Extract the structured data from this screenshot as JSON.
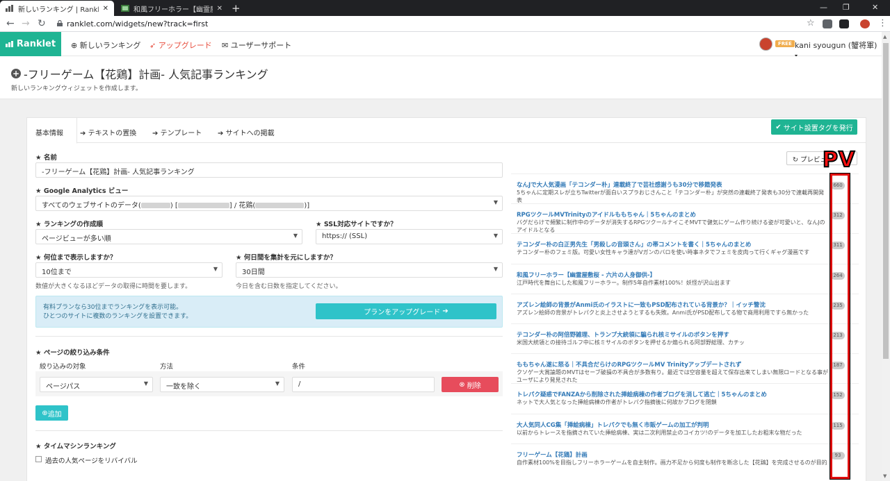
{
  "browser": {
    "tabs": [
      {
        "title": "新しいランキング | Ranklet [ランクレッ",
        "close": "✕"
      },
      {
        "title": "和風フリーホラー【幽霊屋敷桜 - 六片",
        "close": "✕"
      }
    ],
    "new_tab": "+",
    "url": "ranklet.com/widgets/new?track=first",
    "window_controls": {
      "minimize": "—",
      "restore": "❐",
      "close": "✕"
    }
  },
  "appnav": {
    "brand": "Ranklet",
    "links": [
      {
        "label": "新しいランキング",
        "icon": "plus-circle-icon"
      },
      {
        "label": "アップグレード",
        "icon": "rocket-icon"
      },
      {
        "label": "ユーザーサポート",
        "icon": "mail-icon"
      }
    ],
    "plan_badge": "FREE",
    "username": "kani syougun (蟹将軍)"
  },
  "page": {
    "title": "-フリーゲーム【花鶏】計画- 人気記事ランキング",
    "subtitle": "新しいランキングウィジェットを作成します。"
  },
  "tabs": [
    "基本情報",
    "テキストの置換",
    "テンプレート",
    "サイトへの掲載"
  ],
  "issue_tag_button": "サイト設置タグを発行",
  "form": {
    "name_label": "名前",
    "name_value": "-フリーゲーム【花鶏】計画- 人気記事ランキング",
    "ga_label": "Google Analytics ビュー",
    "ga_value_prefix": "すべてのウェブサイトのデータ(",
    "ga_value_mid1": ") [",
    "ga_value_mid2": "] / 花鶏(",
    "ga_value_suffix": ")]",
    "order_label": "ランキングの作成順",
    "order_value": "ページビューが多い順",
    "ssl_label": "SSL対応サイトですか？",
    "ssl_value": "https:// (SSL)",
    "count_label": "何位まで表示しますか？",
    "count_value": "10位まで",
    "count_help": "数値が大きくなるほどデータの取得に時間を要します。",
    "days_label": "何日間を集計を元にしますか？",
    "days_value": "30日間",
    "days_help": "今日を含む日数を指定してください。",
    "info_line1": "有料プランなら30位までランキングを表示可能。",
    "info_line2": "ひとつのサイトに複数のランキングを設置できます。",
    "upgrade_button": "プランをアップグレード",
    "filter_label": "ページの絞り込み条件",
    "filter_cols": [
      "絞り込みの対象",
      "方法",
      "条件"
    ],
    "filter_target": "ページパス",
    "filter_method": "一致を除く",
    "filter_value": "/",
    "delete_button": "削除",
    "add_button": "追加",
    "timemachine_label": "タイムマシンランキング",
    "timemachine_checkbox": "過去の人気ページをリバイバル"
  },
  "preview_button": "プレビュー",
  "annotation": "PV",
  "ranking": [
    {
      "title": "なんJで大人気漫画「テコンダー朴」連載終了で芸社感謝うも30分で移籍発表",
      "desc": "5ちゃんに定期スレが立ちTwitterが面白いスプラおじさんこと「テコンダー朴」が突然の連載終了発表も30分で連載再開発表",
      "pv": 660
    },
    {
      "title": "RPGツクールMVTrinityのアイドルももちゃん｜5ちゃんのまとめ",
      "desc": "バグだらけで頻繁に制作中のデータが消失するRPGツクールナイこそMVTで健気にゲーム作り続ける姿が可愛いと、なんJのアイドルとなる",
      "pv": 312
    },
    {
      "title": "テコンダー朴の白正男先生「男殺しの音頭さん」の帯コメントを書く｜5ちゃんのまとめ",
      "desc": "テコンダー朴のフェミ版。可愛い女性キャラ達がVガンのバロを使い時事ネタでフェミを皮肉って行くギャグ漫画です",
      "pv": 311
    },
    {
      "title": "和風フリーホラー【幽霊屋敷桜 - 六片の人身御供-】",
      "desc": "江戸時代を舞台にした和風フリーホラー。制作5年自作素材100%！妖怪が沢山出ます",
      "pv": 264
    },
    {
      "title": "アズレン絵師の背景がAnmi氏のイラストに一致もPSD配布されている背景か？｜イッチ警沈",
      "desc": "アズレン絵師の背景がトレパクと炎上させようとするも失敗。Anmi氏がPSD配布してる物で商用利用ですら無かった",
      "pv": 235
    },
    {
      "title": "テコンダー朴の阿倍野雑理、トランプ大統領に騙られ核ミサイルのボタンを押す",
      "desc": "米国大統領との接待ゴルフ中に核ミサイルのボタンを押せるか煽られる阿部野総理、カチッ",
      "pv": 213
    },
    {
      "title": "ももちゃん遂に怒る｜不具合だらけのRPGツクールMV Trinityアップデートされず",
      "desc": "クソゲー大賞論題のMVTはセーブ破損の不具合が多数有り。最近では空容量を超えて保存出来てしまい無限ロードとなる事が ユーザにより発見された",
      "pv": 187
    },
    {
      "title": "トレパク疑惑でFANZAから削除された挿絵病棟の作者ブログを消して逃亡｜5ちゃんのまとめ",
      "desc": "ネットで大人気となった挿絵病棟の作者がトレパク指摘後に何故かブログを閉鎖",
      "pv": 152
    },
    {
      "title": "大人気同人CG集「挿絵病棟」トレパクでも無く市販ゲームの加工が判明",
      "desc": "以前からトレースを指摘されていた挿絵病棟、実は二次利用禁止のコイカツ!のデータを加工したお粗末な物だった",
      "pv": 115
    },
    {
      "title": "フリーゲーム【花鶏】計画",
      "desc": "自作素材100%を目指しフリーホラーゲームを自主制作。画力不足から何度も制作を断念した【花鶏】を完成させるのが目的",
      "pv": 93
    }
  ]
}
